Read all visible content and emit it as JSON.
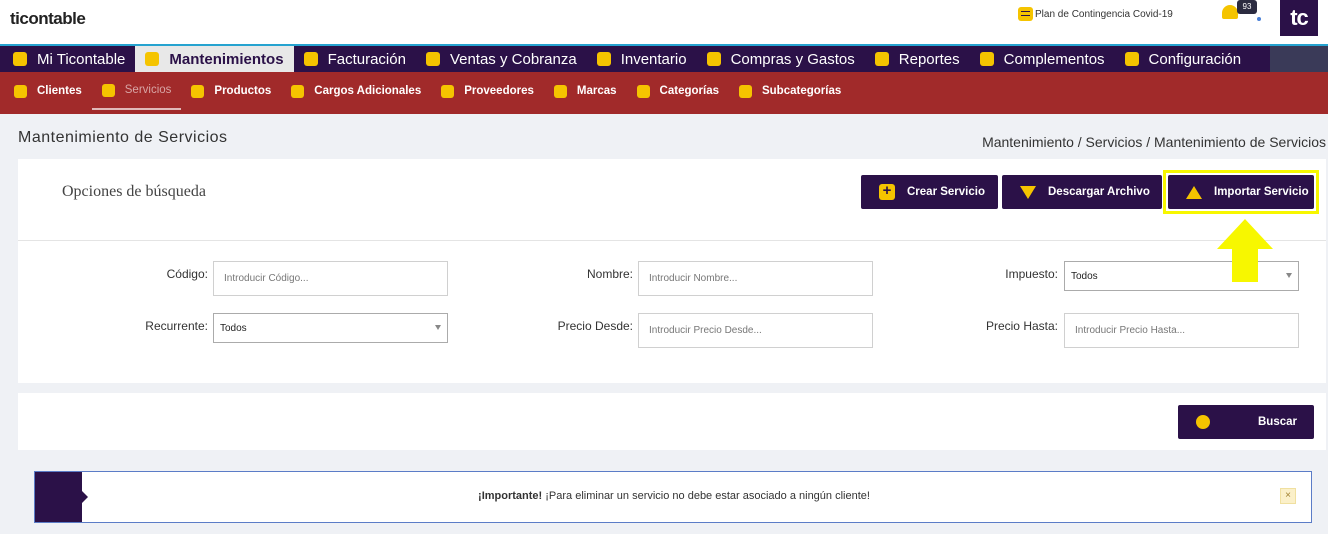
{
  "topbar": {
    "logo": "ticontable",
    "covid_link": "Plan de Contingencia Covid-19",
    "notification_count": "93",
    "avatar": "tc"
  },
  "main_nav": [
    {
      "label": "Mi Ticontable",
      "icon": "home-icon"
    },
    {
      "label": "Mantenimientos",
      "icon": "gear-sun-icon",
      "active": true
    },
    {
      "label": "Facturación",
      "icon": "invoice-icon"
    },
    {
      "label": "Ventas y Cobranza",
      "icon": "money-icon"
    },
    {
      "label": "Inventario",
      "icon": "boxes-icon"
    },
    {
      "label": "Compras y Gastos",
      "icon": "bag-icon"
    },
    {
      "label": "Reportes",
      "icon": "chart-icon"
    },
    {
      "label": "Complementos",
      "icon": "plus-icon"
    },
    {
      "label": "Configuración",
      "icon": "gear-icon"
    }
  ],
  "sub_nav": [
    {
      "label": "Clientes",
      "icon": "user-icon"
    },
    {
      "label": "Servicios",
      "icon": "service-icon",
      "active": true
    },
    {
      "label": "Productos",
      "icon": "layers-icon"
    },
    {
      "label": "Cargos Adicionales",
      "icon": "card-icon"
    },
    {
      "label": "Proveedores",
      "icon": "boxes-icon"
    },
    {
      "label": "Marcas",
      "icon": "flag-icon"
    },
    {
      "label": "Categorías",
      "icon": "folder-icon"
    },
    {
      "label": "Subcategorías",
      "icon": "folder-icon"
    }
  ],
  "page": {
    "title": "Mantenimiento de Servicios",
    "breadcrumb": "Mantenimiento / Servicios / Mantenimiento de Servicios"
  },
  "search": {
    "heading": "Opciones de búsqueda",
    "buttons": {
      "create": "Crear Servicio",
      "download": "Descargar Archivo",
      "import": "Importar Servicio"
    },
    "fields": {
      "codigo_label": "Código:",
      "codigo_placeholder": "Introducir Código...",
      "nombre_label": "Nombre:",
      "nombre_placeholder": "Introducir Nombre...",
      "impuesto_label": "Impuesto:",
      "impuesto_value": "Todos",
      "recurrente_label": "Recurrente:",
      "recurrente_value": "Todos",
      "precio_desde_label": "Precio Desde:",
      "precio_desde_placeholder": "Introducir Precio Desde...",
      "precio_hasta_label": "Precio Hasta:",
      "precio_hasta_placeholder": "Introducir Precio Hasta..."
    },
    "search_button": "Buscar"
  },
  "alert": {
    "strong": "¡Importante!",
    "text": " ¡Para eliminar un servicio no debe estar asociado a ningún cliente!",
    "close": "×"
  },
  "colors": {
    "brand_dark": "#2b1148",
    "accent_yellow": "#f5c400",
    "subnav_red": "#a12a2a",
    "highlight_yellow": "#f7f700"
  }
}
